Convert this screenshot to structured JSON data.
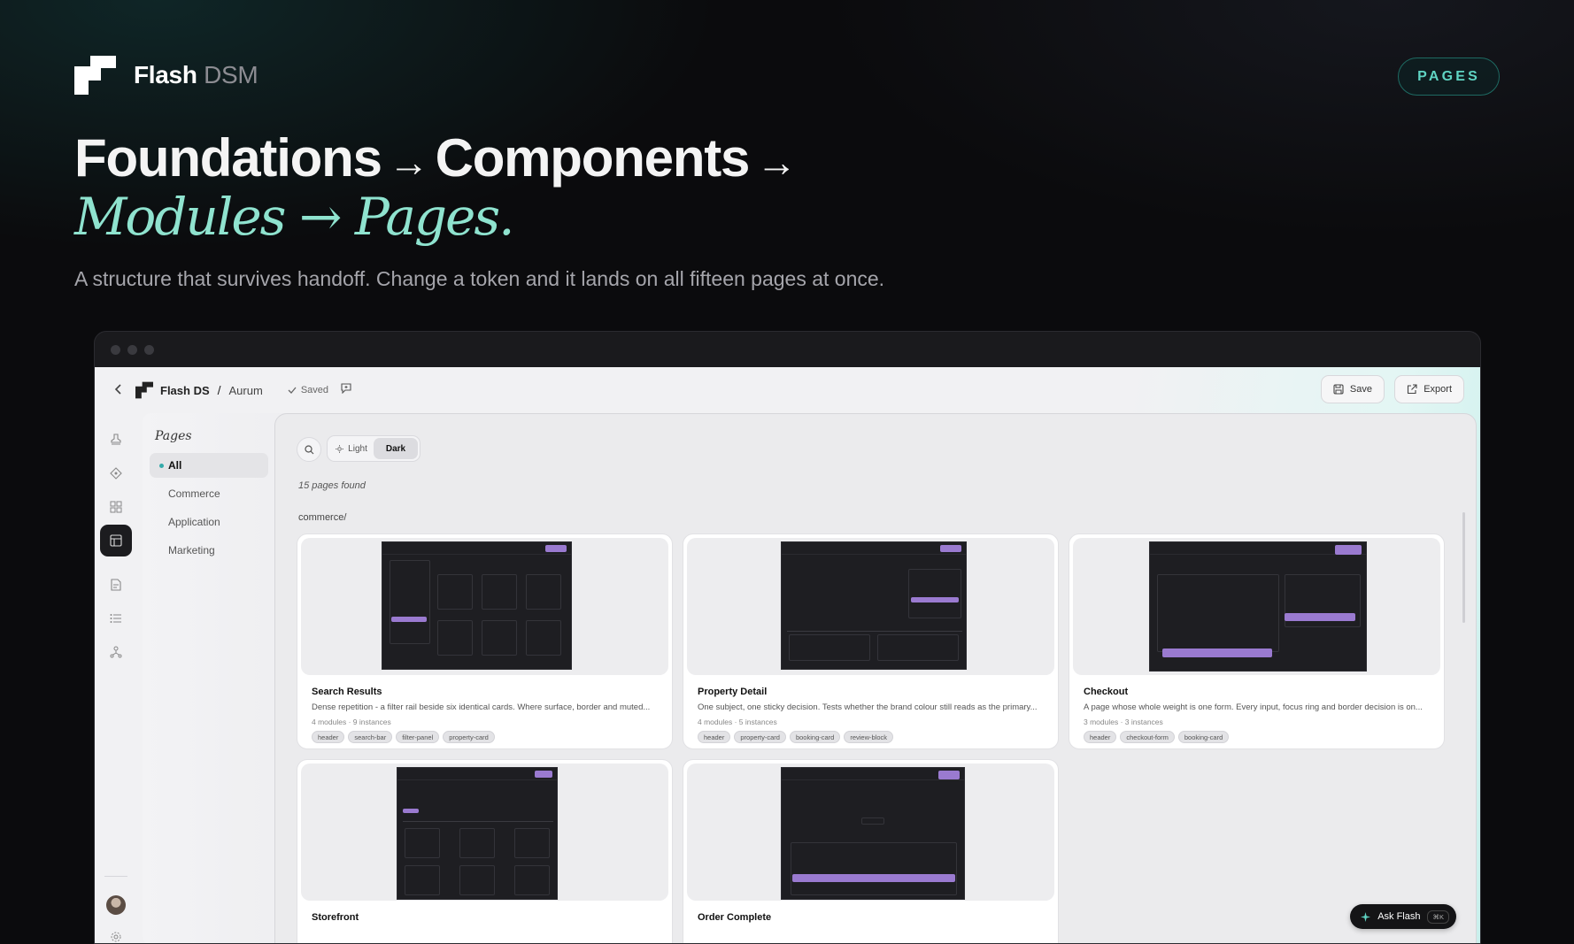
{
  "hero": {
    "logo_name": "Flash",
    "logo_suffix": "DSM",
    "badge": "PAGES",
    "title_a": "Foundations",
    "title_arrow1": "→",
    "title_b": "Components",
    "title_arrow2": "→",
    "title_italic": "Modules → Pages.",
    "lead": "A structure that survives handoff. Change a token and it lands on all fifteen pages at once."
  },
  "topbar": {
    "back_icon": "chevron-left-icon",
    "ds_name": "Flash DS",
    "separator": "/",
    "project": "Aurum",
    "saved": "Saved",
    "save": "Save",
    "export": "Export"
  },
  "sidebar": {
    "title": "Pages",
    "items": [
      {
        "label": "All"
      },
      {
        "label": "Commerce"
      },
      {
        "label": "Application"
      },
      {
        "label": "Marketing"
      }
    ]
  },
  "toolbar": {
    "light": "Light",
    "dark": "Dark",
    "selected_theme": "Dark"
  },
  "content": {
    "count": "15 pages found",
    "group": "commerce/",
    "cards": [
      {
        "title": "Search Results",
        "desc": "Dense repetition - a filter rail beside six identical cards. Where surface, border and muted...",
        "meta": "4 modules · 9 instances",
        "tags": [
          "header",
          "search-bar",
          "filter-panel",
          "property-card"
        ]
      },
      {
        "title": "Property Detail",
        "desc": "One subject, one sticky decision. Tests whether the brand colour still reads as the primary...",
        "meta": "4 modules · 5 instances",
        "tags": [
          "header",
          "property-card",
          "booking-card",
          "review-block"
        ]
      },
      {
        "title": "Checkout",
        "desc": "A page whose whole weight is one form. Every input, focus ring and border decision is on...",
        "meta": "3 modules · 3 instances",
        "tags": [
          "header",
          "checkout-form",
          "booking-card"
        ]
      },
      {
        "title": "Storefront",
        "desc": "",
        "meta": "",
        "tags": []
      },
      {
        "title": "Order Complete",
        "desc": "",
        "meta": "",
        "tags": []
      }
    ]
  },
  "ask": {
    "label": "Ask Flash",
    "shortcut": "⌘K"
  },
  "colors": {
    "accent_teal": "#8fe3cf",
    "badge_teal": "#5fd4c3",
    "thumbnail_purple": "#9a7ad0"
  }
}
